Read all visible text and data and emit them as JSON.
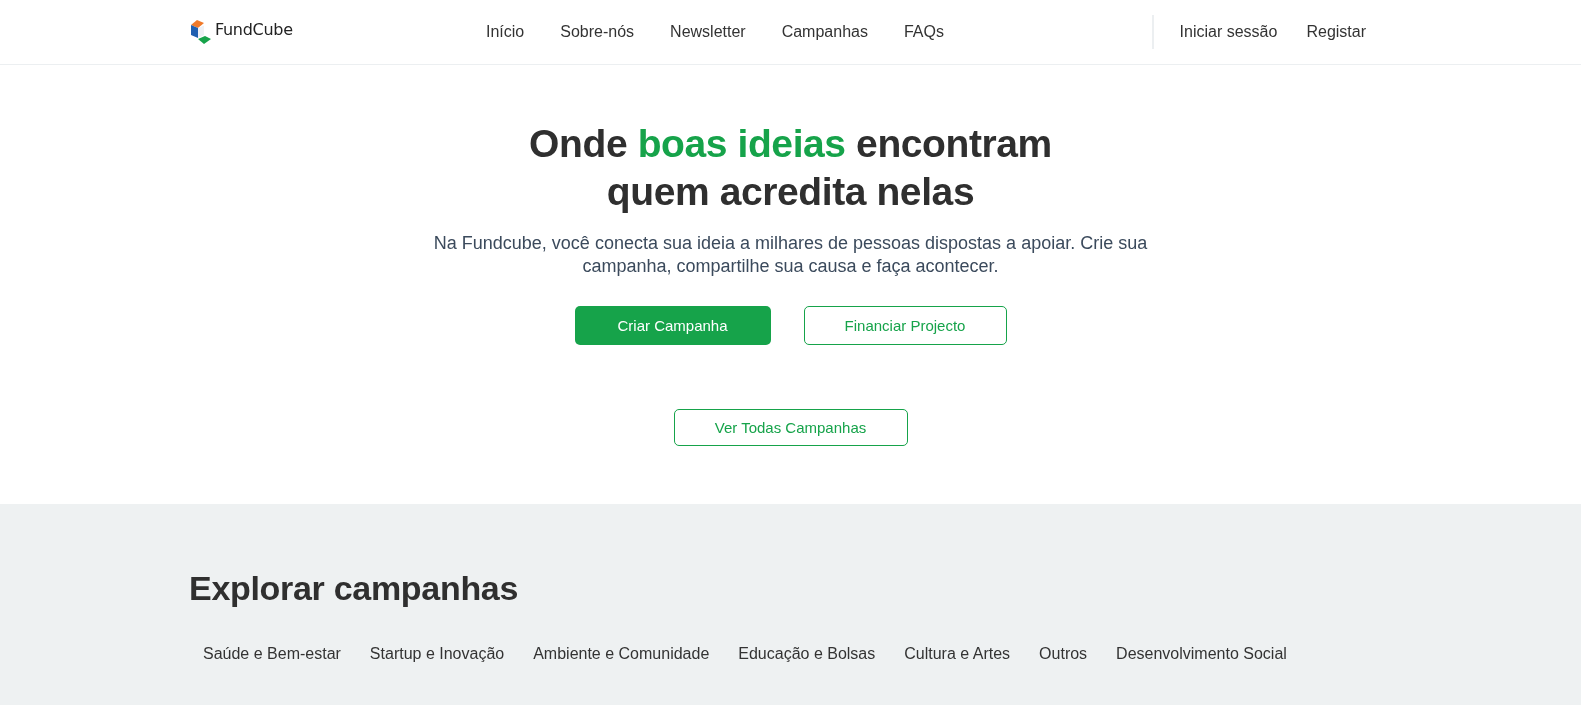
{
  "header": {
    "logo": {
      "text": "FundCube"
    },
    "nav": [
      {
        "label": "Início"
      },
      {
        "label": "Sobre-nós"
      },
      {
        "label": "Newsletter"
      },
      {
        "label": "Campanhas"
      },
      {
        "label": "FAQs"
      }
    ],
    "auth": [
      {
        "label": "Iniciar sessão"
      },
      {
        "label": "Registar"
      }
    ]
  },
  "hero": {
    "title_lines": [
      [
        {
          "text": "Onde ",
          "accent": false
        },
        {
          "text": "boas ideias",
          "accent": true
        },
        {
          "text": " encontram",
          "accent": false
        }
      ],
      [
        {
          "text": "quem acredita nelas",
          "accent": false
        }
      ]
    ],
    "subtitle": "Na Fundcube, você conecta sua ideia a milhares de pessoas dispostas a apoiar. Crie sua campanha, compartilhe sua causa e faça acontecer.",
    "actions": [
      {
        "label": "Criar Campanha",
        "kind": "primary"
      },
      {
        "label": "Financiar Projecto",
        "kind": "outline"
      }
    ],
    "secondary_action": {
      "label": "Ver Todas Campanhas",
      "kind": "outline"
    }
  },
  "explore": {
    "title": "Explorar campanhas",
    "categories": [
      {
        "label": "Saúde e Bem-estar"
      },
      {
        "label": "Startup e Inovação"
      },
      {
        "label": "Ambiente e Comunidade"
      },
      {
        "label": "Educação e Bolsas"
      },
      {
        "label": "Cultura e Artes"
      },
      {
        "label": "Outros"
      },
      {
        "label": "Desenvolvimento Social"
      }
    ]
  }
}
